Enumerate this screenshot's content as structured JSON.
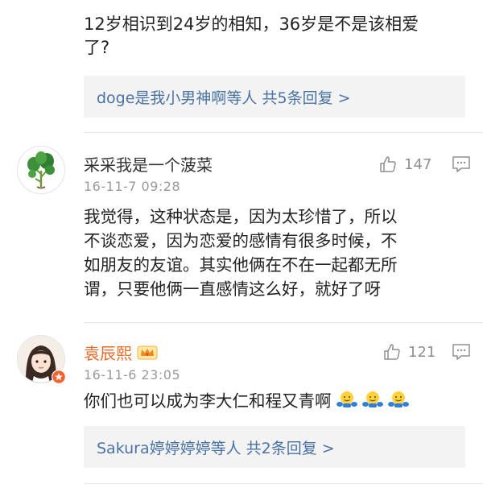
{
  "comment0": {
    "text_line1": "12岁相识到24岁的相知，36岁是不是该相爱",
    "text_line2": "了?",
    "replies_link": "doge是我小男神啊等人  共5条回复 >"
  },
  "comment1": {
    "username": "采采我是一个菠菜",
    "timestamp": "16-11-7 09:28",
    "likes": "147",
    "text_line1": "我觉得，这种状态是，因为太珍惜了，所以",
    "text_line2": "不谈恋爱，因为恋爱的感情有很多时候，不",
    "text_line3": "如朋友的友谊。其实他俩在不在一起都无所",
    "text_line4": "谓，只要他俩一直感情这么好，就好了呀"
  },
  "comment2": {
    "username": "袁辰熙",
    "timestamp": "16-11-6 23:05",
    "likes": "121",
    "text": "你们也可以成为李大仁和程又青啊",
    "emoji_count": 3,
    "replies_link": "Sakura婷婷婷婷等人  共2条回复 >"
  },
  "icons": {
    "like": "thumbs-up-icon",
    "comment": "comment-bubble-icon",
    "vip_badge": "crown-badge-icon",
    "emoji": "hugging-face-emoji"
  },
  "colors": {
    "link_blue": "#4a73a5",
    "vip_orange": "#e86a27",
    "meta_gray": "#9a9a9a",
    "reply_bg": "#f3f3f3"
  }
}
